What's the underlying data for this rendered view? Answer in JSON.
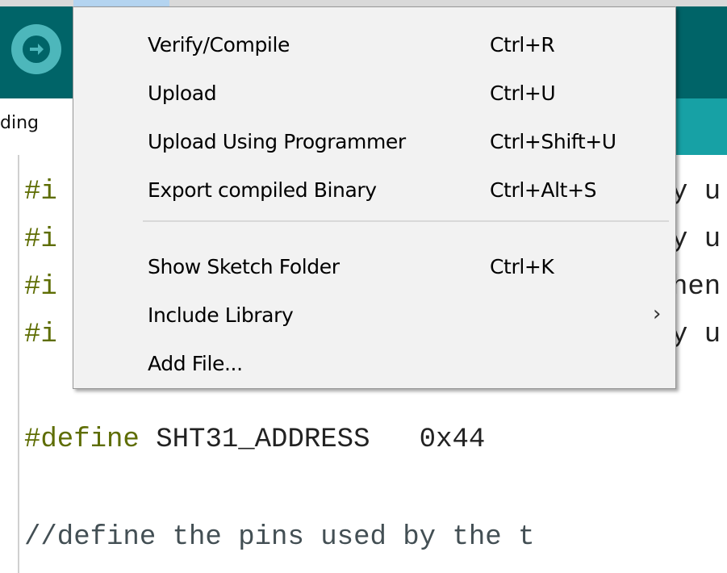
{
  "tab": {
    "label": "ding"
  },
  "menu": {
    "items": [
      {
        "label": "Verify/Compile",
        "shortcut": "Ctrl+R"
      },
      {
        "label": "Upload",
        "shortcut": "Ctrl+U"
      },
      {
        "label": "Upload Using Programmer",
        "shortcut": "Ctrl+Shift+U"
      },
      {
        "label": "Export compiled Binary",
        "shortcut": "Ctrl+Alt+S"
      },
      {
        "label": "Show Sketch Folder",
        "shortcut": "Ctrl+K"
      },
      {
        "label": "Include Library",
        "shortcut": "",
        "submenu_icon": "chevron-right-icon"
      },
      {
        "label": "Add File...",
        "shortcut": ""
      }
    ]
  },
  "code": {
    "include_prefix": "#i",
    "line1_tail": "y u",
    "line2_tail": "y u",
    "line3_tail": "hen",
    "line4_tail": "y u",
    "define_kw": "#define",
    "define_rest": " SHT31_ADDRESS   0x44",
    "comment": "//define the pins used by the t"
  },
  "colors": {
    "toolbar": "#006468",
    "tab_bar": "#17a1a5",
    "keyword": "#5e6d03",
    "menu_bg": "#f2f2f2"
  }
}
